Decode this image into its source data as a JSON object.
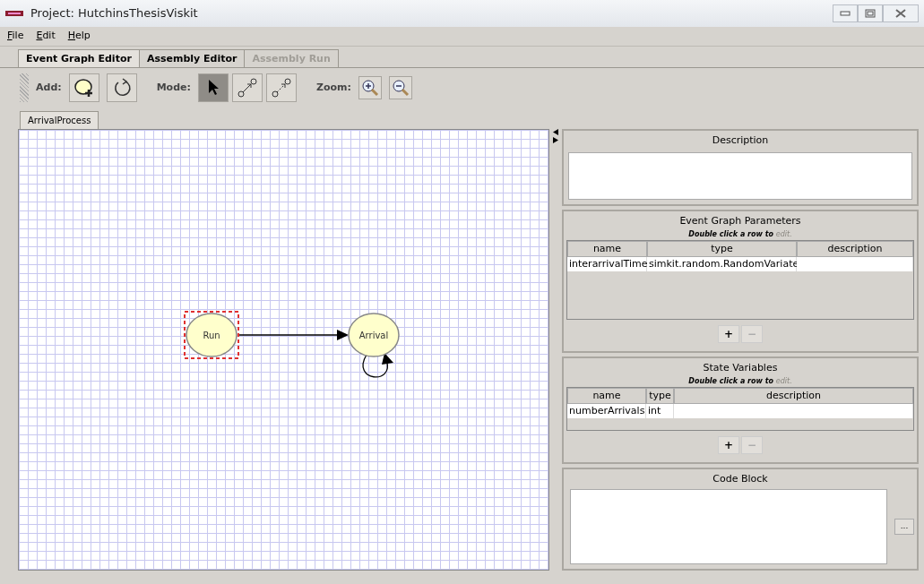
{
  "window": {
    "title": "Project: HutchinsThesisViskit"
  },
  "menu": [
    "File",
    "Edit",
    "Help"
  ],
  "tabs": [
    {
      "label": "Event Graph Editor",
      "selected": true,
      "disabled": false
    },
    {
      "label": "Assembly Editor",
      "selected": false,
      "disabled": false
    },
    {
      "label": "Assembly Run",
      "selected": false,
      "disabled": true
    }
  ],
  "toolbar": {
    "add_label": "Add:",
    "mode_label": "Mode:",
    "zoom_label": "Zoom:",
    "modes": [
      {
        "kind": "select",
        "selected": true
      },
      {
        "kind": "edge",
        "selected": false
      },
      {
        "kind": "cancelling-edge",
        "selected": false
      }
    ]
  },
  "document_tabs": [
    {
      "label": "ArrivalProcess",
      "selected": true
    }
  ],
  "graph": {
    "nodes": [
      {
        "label": "Run",
        "selected": true
      },
      {
        "label": "Arrival",
        "selected": false
      }
    ],
    "edges": [
      {
        "kind": "scheduling"
      },
      {
        "kind": "self-loop"
      }
    ]
  },
  "description": {
    "title": "Description"
  },
  "parameters": {
    "title": "Event Graph Parameters",
    "hint": "Double click a row to",
    "hint_action": "edit.",
    "columns": [
      "name",
      "type",
      "description"
    ],
    "rows": [
      [
        "interarrivalTime",
        "simkit.random.RandomVariate"
      ]
    ],
    "buttons": [
      {
        "label": "+",
        "disabled": false
      },
      {
        "label": "−",
        "disabled": true
      }
    ]
  },
  "state_variables": {
    "title": "State Variables",
    "hint": "Double click a row to",
    "hint_action": "edit.",
    "columns": [
      "name",
      "type",
      "description"
    ],
    "rows": [
      [
        "numberArrivals",
        "int"
      ]
    ],
    "buttons": [
      {
        "label": "+",
        "disabled": false
      },
      {
        "label": "−",
        "disabled": true
      }
    ]
  },
  "code_block": {
    "title": "Code Block",
    "button": "..."
  }
}
